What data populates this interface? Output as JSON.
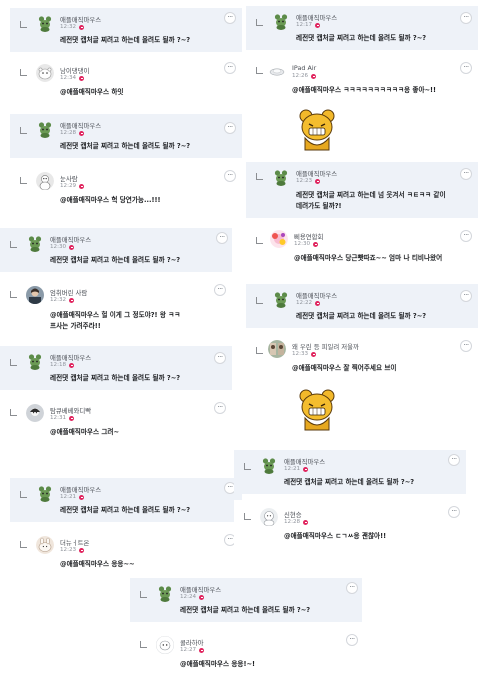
{
  "icons": {
    "reply_corner": "reply-indent-icon",
    "more": "ellipsis-icon",
    "time_badge": "red-badge-icon",
    "sticker": "yellow-bear-sticker"
  },
  "colors": {
    "post_background": "#eef2f8",
    "badge": "#e0245e",
    "text": "#1c1e21",
    "meta": "#90949c"
  },
  "comments": [
    {
      "user": "애플매직마우스",
      "time": "12:32",
      "text": "레전댓 캡처글 찌려고 하는데 올려도 될까 ?~?"
    },
    {
      "user": "남이댕댕이",
      "time": "12:34",
      "text": "@애플매직마우스 하잇"
    },
    {
      "user": "애플매직마우스",
      "time": "12:28",
      "text": "레전댓 캡처글 찌려고 하는데 올려도 될까 ?~?"
    },
    {
      "user": "눈사람",
      "time": "12:29",
      "text": "@애플매직마우스 헉 당연가능...!!!"
    },
    {
      "user": "애플매직마우스",
      "time": "12:30",
      "text": "레전댓 캡처글 찌려고 하는데 올려도 될까 ?~?"
    },
    {
      "user": "엄취버린 사람",
      "time": "12:32",
      "text_line1": "@애플매직마우스 헐 이게 그 정도야?! 왕 ㅋㅋ",
      "text_line2": "프사는 가려주라!!"
    },
    {
      "user": "애플매직마우스",
      "time": "12:18",
      "text": "레전댓 캡처글 찌려고 하는데 올려도 될까 ?~?"
    },
    {
      "user": "탐큐베베와디빡",
      "time": "12:31",
      "text": "@애플매직마우스 그려~"
    },
    {
      "user": "애플매직마우스",
      "time": "12:21",
      "text": "레전댓 캡처글 찌려고 하는데 올려도 될까 ?~?"
    },
    {
      "user": "더뉴ㅓ트온",
      "time": "12:23",
      "text": "@애플매직마우스 응응~~"
    },
    {
      "user": "애플매직마우스",
      "time": "12:17",
      "text": "레전댓 캡처글 찌려고 하는데 올려도 될까 ?~?"
    },
    {
      "user": "IPad Air",
      "time": "12:26",
      "text": "@애플매직마우스 ㅋㅋㅋㅋㅋㅋㅋㅋㅋㅋ응 좋아~!!"
    },
    {
      "user": "애플매직마우스",
      "time": "12:23",
      "text_line1": "레전댓 캡처글 찌려고 하는데 넘 웃겨서 ㅋㅌㅋㅋ 같이",
      "text_line2": "데려가도 될까?!"
    },
    {
      "user": "삐용연합회",
      "time": "12:30",
      "text": "@애플매직마우스 당근빳따죠~~ 엄마 나 티비나왔어"
    },
    {
      "user": "애플매직마우스",
      "time": "12:22",
      "text": "레전댓 캡처글 찌려고 하는데 올려도 될까 ?~?"
    },
    {
      "user": "왜 우린 등 피일려 저울까",
      "time": "12:33",
      "text": "@애플매직마우스 잘 찍어주세요 브이"
    },
    {
      "user": "애플매직마우스",
      "time": "12:21",
      "text": "레전댓 캡처글 찌려고 하는데 올려도 될까 ?~?"
    },
    {
      "user": "신현승",
      "time": "12:28",
      "text": "@애플매직마우스 ㄷㄱㅆ응 괜찮아!!"
    },
    {
      "user": "애플매직마우스",
      "time": "12:24",
      "text": "레전댓 캡처글 찌려고 하는데 올려도 될까 ?~?"
    },
    {
      "user": "콜라하아",
      "time": "12:27",
      "text": "@애플매직마우스 응응!~!"
    }
  ]
}
